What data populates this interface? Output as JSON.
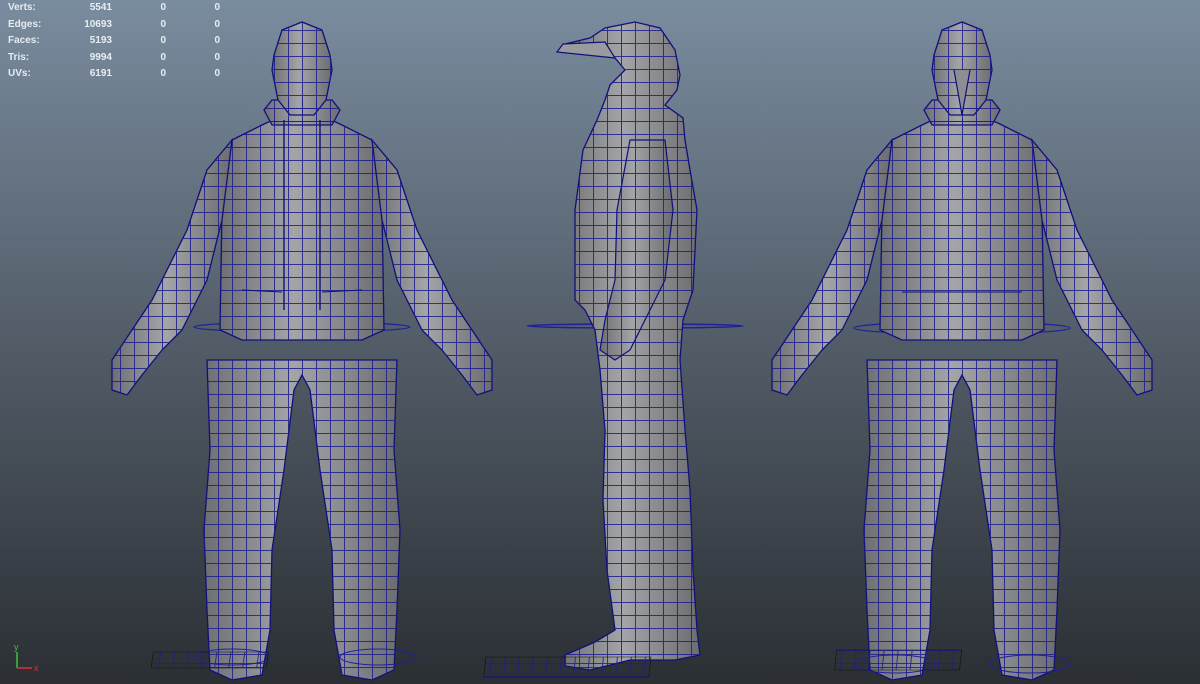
{
  "hud": {
    "rows": [
      {
        "label": "Verts:",
        "total": "5541",
        "selected": "0",
        "component": "0"
      },
      {
        "label": "Edges:",
        "total": "10693",
        "selected": "0",
        "component": "0"
      },
      {
        "label": "Faces:",
        "total": "5193",
        "selected": "0",
        "component": "0"
      },
      {
        "label": "Tris:",
        "total": "9994",
        "selected": "0",
        "component": "0"
      },
      {
        "label": "UVs:",
        "total": "6191",
        "selected": "0",
        "component": "0"
      }
    ]
  },
  "axis": {
    "y": "y",
    "x": "x"
  },
  "colors": {
    "wire": "#14148a",
    "mesh": "#8a8b8e",
    "bg_top": "#7a8c9f",
    "bg_bottom": "#2b2f34",
    "axis_x": "#e0302a",
    "axis_y": "#3ac23a"
  },
  "views": [
    "front-view",
    "side-view",
    "back-view"
  ]
}
